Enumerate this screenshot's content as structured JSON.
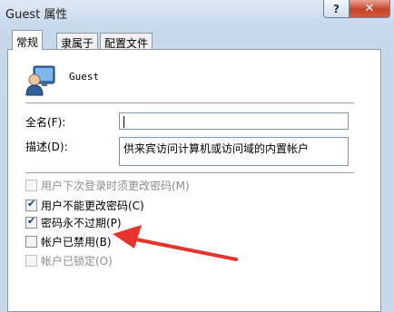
{
  "window": {
    "title": "Guest 属性",
    "help_label": "?",
    "close_label": "✕"
  },
  "tabs": [
    {
      "label": "常规"
    },
    {
      "label": "隶属于"
    },
    {
      "label": "配置文件"
    }
  ],
  "user": {
    "name": "Guest",
    "icon": "user-icon"
  },
  "fields": {
    "full_name_label": "全名(F):",
    "full_name_value": "",
    "description_label": "描述(D):",
    "description_value": "供来宾访问计算机或访问域的内置帐户"
  },
  "options": [
    {
      "label": "用户下次登录时须更改密码(M)",
      "checked": false,
      "disabled": true
    },
    {
      "label": "用户不能更改密码(C)",
      "checked": true,
      "disabled": false
    },
    {
      "label": "密码永不过期(P)",
      "checked": true,
      "disabled": false
    },
    {
      "label": "帐户已禁用(B)",
      "checked": false,
      "disabled": false
    },
    {
      "label": "帐户已锁定(O)",
      "checked": false,
      "disabled": true
    }
  ],
  "annotation": {
    "arrow_color": "#e8322c"
  }
}
